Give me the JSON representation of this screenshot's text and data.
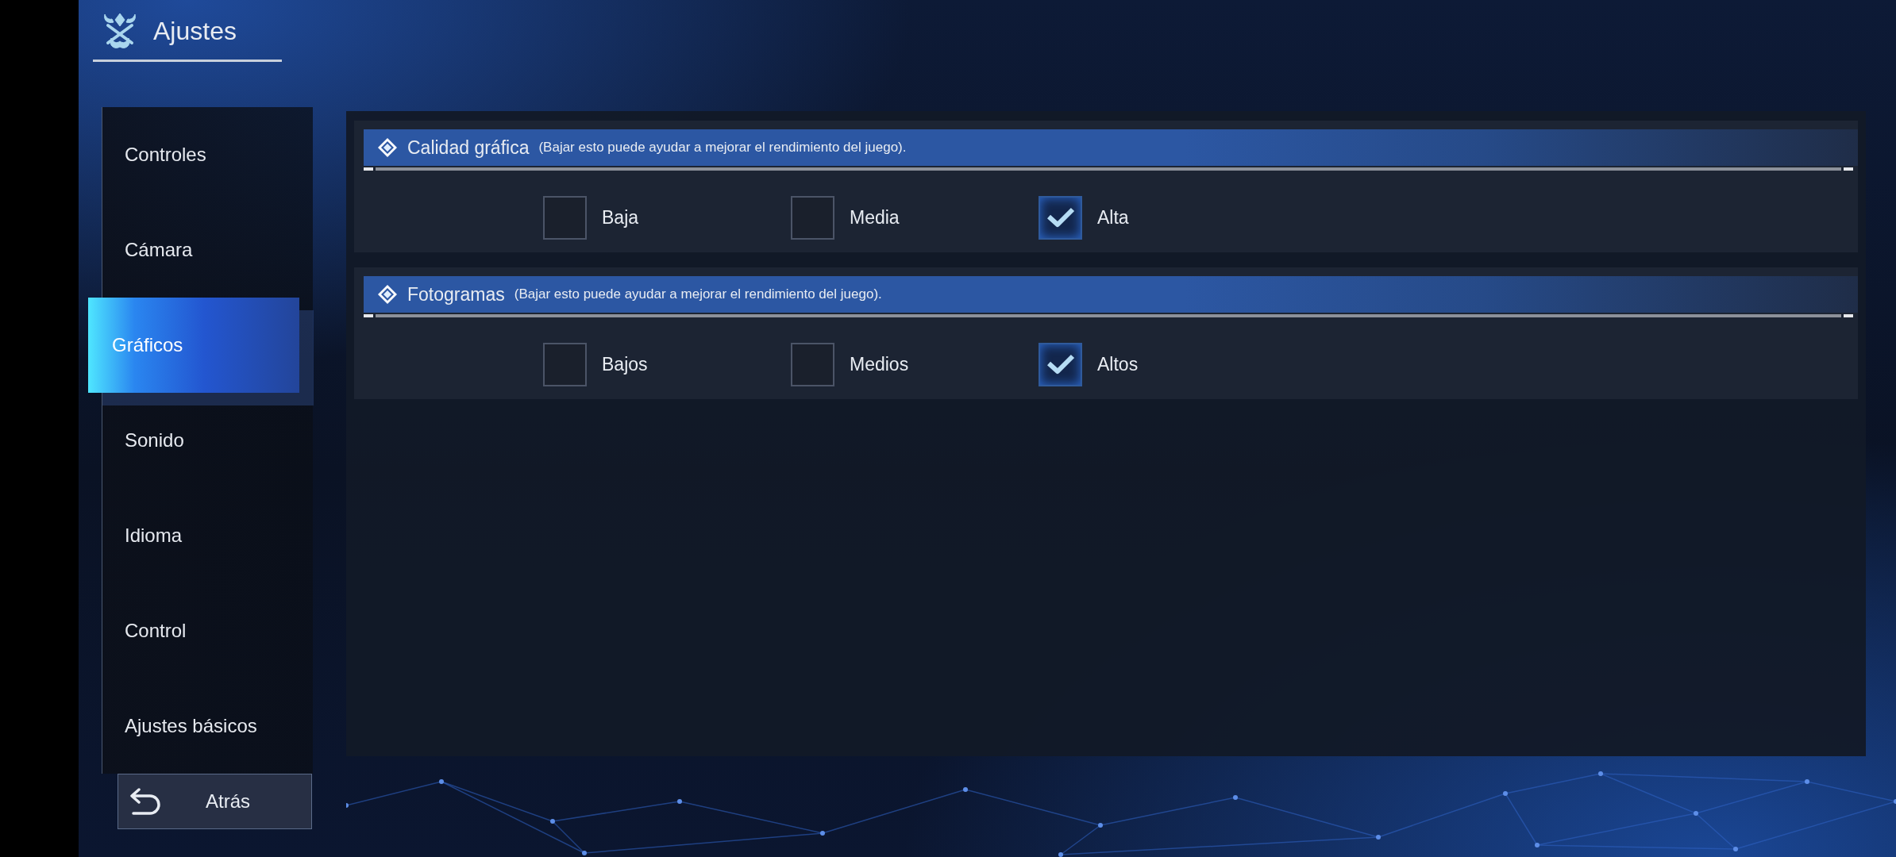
{
  "header": {
    "title": "Ajustes"
  },
  "sidebar": {
    "items": [
      {
        "label": "Controles",
        "selected": false
      },
      {
        "label": "Cámara",
        "selected": false
      },
      {
        "label": "Gráficos",
        "selected": true
      },
      {
        "label": "Sonido",
        "selected": false
      },
      {
        "label": "Idioma",
        "selected": false
      },
      {
        "label": "Control",
        "selected": false
      },
      {
        "label": "Ajustes básicos",
        "selected": false
      }
    ]
  },
  "back_button": {
    "label": "Atrás"
  },
  "sections": [
    {
      "title": "Calidad gráfica",
      "hint": "(Bajar esto puede ayudar a mejorar el rendimiento del juego).",
      "options": [
        {
          "label": "Baja",
          "checked": false
        },
        {
          "label": "Media",
          "checked": false
        },
        {
          "label": "Alta",
          "checked": true
        }
      ]
    },
    {
      "title": "Fotogramas",
      "hint": "(Bajar esto puede ayudar a mejorar el rendimiento del juego).",
      "options": [
        {
          "label": "Bajos",
          "checked": false
        },
        {
          "label": "Medios",
          "checked": false
        },
        {
          "label": "Altos",
          "checked": true
        }
      ]
    }
  ]
}
